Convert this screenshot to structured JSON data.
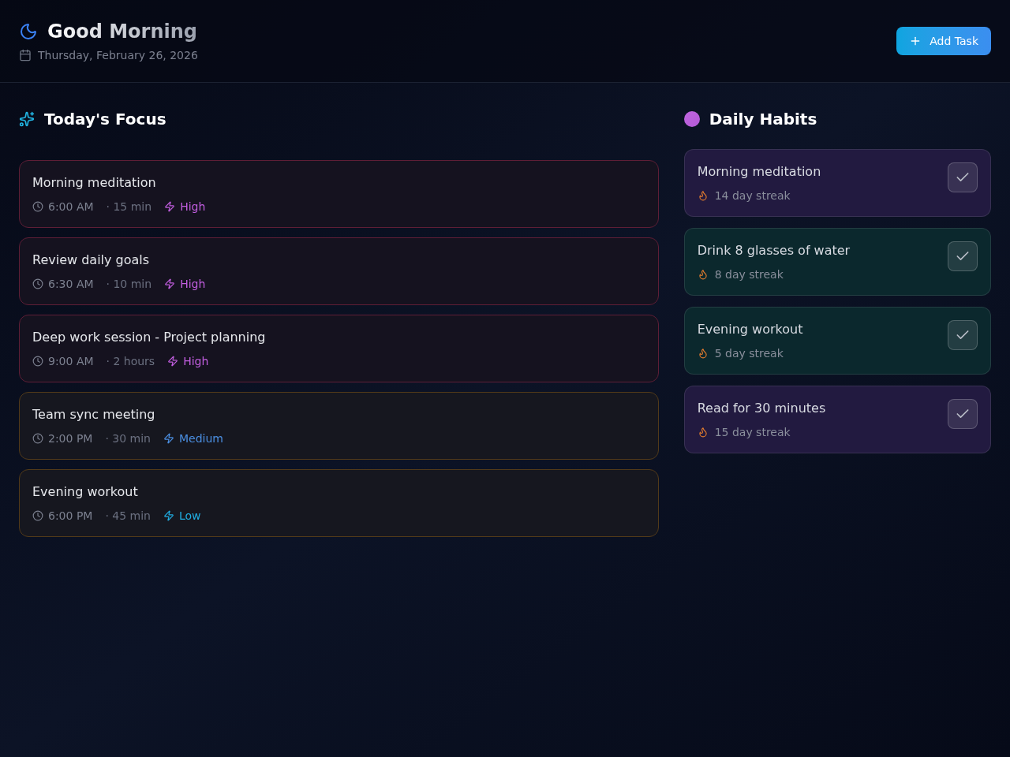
{
  "header": {
    "title": "Good Morning",
    "date": "Thursday, February 26, 2026",
    "add_button": "Add Task"
  },
  "focus": {
    "title": "Today's Focus",
    "tasks": [
      {
        "title": "Morning meditation",
        "time": "6:00 AM",
        "duration": "· 15 min",
        "priority": {
          "label": "High",
          "kind": "high"
        }
      },
      {
        "title": "Review daily goals",
        "time": "6:30 AM",
        "duration": "· 10 min",
        "priority": {
          "label": "High",
          "kind": "high"
        }
      },
      {
        "title": "Deep work session - Project planning",
        "time": "9:00 AM",
        "duration": "· 2 hours",
        "priority": {
          "label": "High",
          "kind": "high"
        }
      },
      {
        "title": "Team sync meeting",
        "time": "2:00 PM",
        "duration": "· 30 min",
        "priority": {
          "label": "Medium",
          "kind": "medium"
        }
      },
      {
        "title": "Evening workout",
        "time": "6:00 PM",
        "duration": "· 45 min",
        "priority": {
          "label": "Low",
          "kind": "low"
        }
      }
    ]
  },
  "habits": {
    "title": "Daily Habits",
    "items": [
      {
        "name": "Morning meditation",
        "streak": "14 day streak",
        "color": "#221a40",
        "checked": true
      },
      {
        "name": "Drink 8 glasses of water",
        "streak": "8 day streak",
        "color": "#0b282d",
        "checked": true
      },
      {
        "name": "Evening workout",
        "streak": "5 day streak",
        "color": "#0b282d",
        "checked": true
      },
      {
        "name": "Read for 30 minutes",
        "streak": "15 day streak",
        "color": "#221a40",
        "checked": true
      }
    ]
  }
}
